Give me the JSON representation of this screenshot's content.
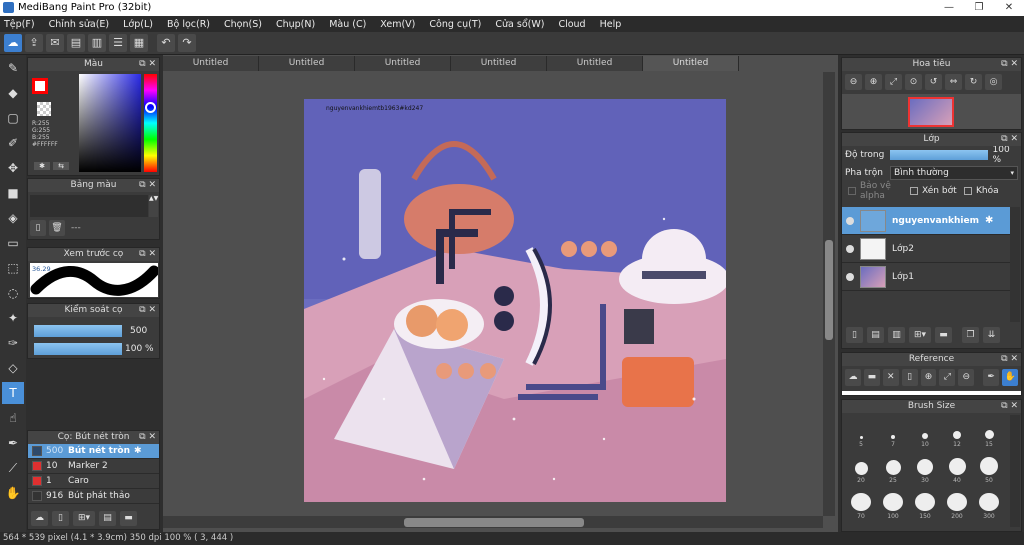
{
  "window": {
    "title": "MediBang Paint Pro (32bit)",
    "ghost_tabs": [
      "",
      "",
      "",
      "",
      "",
      "",
      ""
    ]
  },
  "menu": [
    "Tệp(F)",
    "Chỉnh sửa(E)",
    "Lớp(L)",
    "Bộ lọc(R)",
    "Chọn(S)",
    "Chụp(N)",
    "Màu (C)",
    "Xem(V)",
    "Công cụ(T)",
    "Cửa sổ(W)",
    "Cloud",
    "Help"
  ],
  "doc_tabs": [
    "Untitled",
    "Untitled",
    "Untitled",
    "Untitled",
    "Untitled",
    "Untitled"
  ],
  "panels": {
    "color": {
      "title": "Màu",
      "r": "R:255",
      "g": "G:255",
      "b": "B:255",
      "hex": "#FFFFFF",
      "primary_color": "#ff0000"
    },
    "palette": {
      "title": "Bảng màu",
      "placeholder": "---"
    },
    "brush_preview": {
      "title": "Xem trước cọ",
      "zoom": "36.29"
    },
    "brush_control": {
      "title": "Kiểm soát cọ",
      "size": "500",
      "opacity": "100 %"
    },
    "brush_list": {
      "title": "Cọ: Bút nét tròn",
      "items": [
        {
          "size": "500",
          "name": "Bút nét tròn",
          "color": "#2f4a6a"
        },
        {
          "size": "10",
          "name": "Marker 2",
          "color": "#e03030"
        },
        {
          "size": "1",
          "name": "Caro",
          "color": "#e03030"
        },
        {
          "size": "916",
          "name": "Bút phát thảo",
          "color": "#333333"
        }
      ]
    },
    "navigator": {
      "title": "Hoa tiêu"
    },
    "layers": {
      "title": "Lớp",
      "opacity_label": "Độ trong",
      "opacity_value": "100 %",
      "blend_label": "Pha trộn",
      "blend_value": "Bình thường",
      "protect_alpha": "Bảo vệ alpha",
      "clip": "Xén bớt",
      "lock": "Khóa",
      "items": [
        {
          "name": "nguyenvankhiem"
        },
        {
          "name": "Lớp2"
        },
        {
          "name": "Lớp1"
        }
      ]
    },
    "reference": {
      "title": "Reference"
    },
    "brush_size": {
      "title": "Brush Size",
      "sizes": [
        "5",
        "7",
        "10",
        "12",
        "15",
        "20",
        "25",
        "30",
        "40",
        "50",
        "70",
        "100",
        "150",
        "200",
        "300"
      ]
    }
  },
  "canvas": {
    "watermark": "nguyenvankhiemtb1963#kd247"
  },
  "status": "564 * 539 pixel   (4.1 * 3.9cm)   350 dpi   100 %   ( 3, 444 )"
}
